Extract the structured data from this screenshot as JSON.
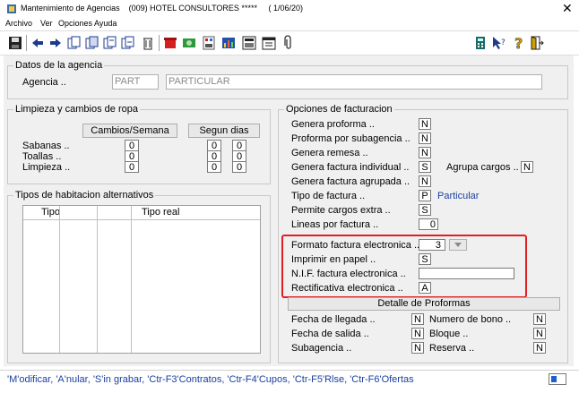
{
  "window": {
    "title": "Mantenimiento de Agencias    (009) HOTEL CONSULTORES *****     ( 1/06/20)",
    "close_glyph": "✕"
  },
  "menu": [
    "Archivo",
    "Ver",
    "Opciones",
    "Ayuda"
  ],
  "toolbar_icons": [
    "save-icon",
    "arrow-left-icon",
    "arrow-right-icon",
    "copy-icon",
    "copy2-icon",
    "copy3-icon",
    "copy4-icon",
    "trash-icon",
    "red-phone-icon",
    "green-money-icon",
    "grid-doc-icon",
    "chart-icon",
    "calculator-display-icon",
    "paperclip-icon",
    "calculator-icon",
    "help-cursor-icon",
    "question-icon",
    "exit-door-icon"
  ],
  "datos_agencia": {
    "title": "Datos de la agencia",
    "agencia_label": "Agencia ..",
    "code_value": "PART",
    "name_value": "PARTICULAR"
  },
  "limpieza": {
    "title": "Limpieza y cambios de ropa",
    "cambios_button": "Cambios/Semana",
    "segun_button": "Segun dias",
    "rows": [
      {
        "label": "Sabanas ..",
        "cambios": "0",
        "dias1": "0",
        "dias2": "0"
      },
      {
        "label": "Toallas ..",
        "cambios": "0",
        "dias1": "0",
        "dias2": "0"
      },
      {
        "label": "Limpieza ..",
        "cambios": "0",
        "dias1": "0",
        "dias2": "0"
      }
    ]
  },
  "tipos": {
    "title": "Tipos de habitacion alternativos",
    "col_tipo": "Tipo",
    "col_tipo_real": "Tipo real"
  },
  "facturacion": {
    "title": "Opciones de facturacion",
    "genera_proforma": {
      "label": "Genera proforma ..",
      "value": "N"
    },
    "proforma_subagencia": {
      "label": "Proforma por subagencia ..",
      "value": "N"
    },
    "genera_remesa": {
      "label": "Genera remesa ..",
      "value": "N"
    },
    "genera_factura_individual": {
      "label": "Genera factura individual ..",
      "value": "S"
    },
    "agrupa_cargos": {
      "label": "Agrupa cargos ..",
      "value": "N"
    },
    "genera_factura_agrupada": {
      "label": "Genera factura agrupada ..",
      "value": "N"
    },
    "tipo_factura": {
      "label": "Tipo de factura ..",
      "value": "P",
      "desc": "Particular"
    },
    "permite_cargos": {
      "label": "Permite cargos extra ..",
      "value": "S"
    },
    "lineas_factura": {
      "label": "Lineas por factura ..",
      "value": "0"
    },
    "formato_electronica": {
      "label": "Formato factura electronica ..",
      "value": "3"
    },
    "imprimir_papel": {
      "label": "Imprimir en papel ..",
      "value": "S"
    },
    "nif_electronica": {
      "label": "N.I.F. factura electronica ..",
      "value": ""
    },
    "rectificativa": {
      "label": "Rectificativa electronica ..",
      "value": "A"
    },
    "detalle_button": "Detalle de Proformas",
    "fecha_llegada": {
      "label": "Fecha de llegada ..",
      "value": "N"
    },
    "numero_bono": {
      "label": "Numero de bono ..",
      "value": "N"
    },
    "fecha_salida": {
      "label": "Fecha de salida ..",
      "value": "N"
    },
    "bloque": {
      "label": "Bloque ..",
      "value": "N"
    },
    "subagencia": {
      "label": "Subagencia ..",
      "value": "N"
    },
    "reserva": {
      "label": "Reserva ..",
      "value": "N"
    }
  },
  "status": {
    "text": "'M'odificar, 'A'nular, 'S'in grabar, 'Ctr-F3'Contratos, 'Ctr-F4'Cupos, 'Ctr-F5'Rlse,  'Ctr-F6'Ofertas"
  },
  "colors": {
    "highlight": "#e02020",
    "link": "#1a3fa0"
  }
}
